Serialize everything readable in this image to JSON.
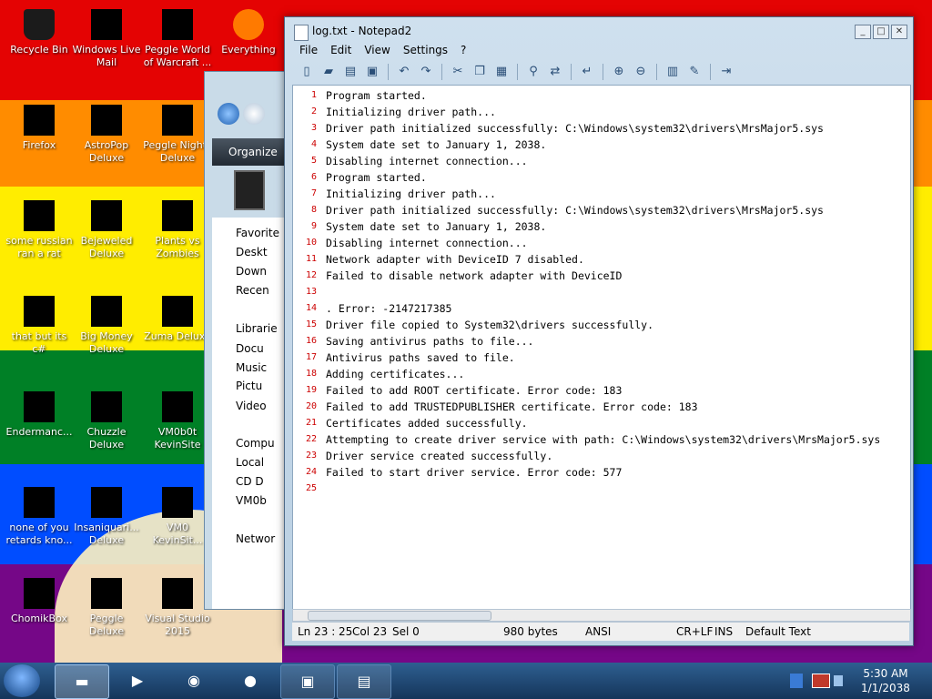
{
  "desktop": {
    "icons": [
      {
        "label": "Recycle Bin"
      },
      {
        "label": "Windows Live Mail"
      },
      {
        "label": "Peggle World of Warcraft ..."
      },
      {
        "label": "Everything"
      },
      {
        "label": "Firefox"
      },
      {
        "label": "AstroPop Deluxe"
      },
      {
        "label": "Peggle Nights Deluxe"
      },
      {
        "label": "some russian ran a rat"
      },
      {
        "label": "Bejeweled Deluxe"
      },
      {
        "label": "Plants vs Zombies"
      },
      {
        "label": "that but its c#"
      },
      {
        "label": "Big Money Deluxe"
      },
      {
        "label": "Zuma Deluxe"
      },
      {
        "label": "Endermanc..."
      },
      {
        "label": "Chuzzle Deluxe"
      },
      {
        "label": "VM0b0t KevinSite"
      },
      {
        "label": "none of you retards kno..."
      },
      {
        "label": "Insaniquari... Deluxe"
      },
      {
        "label": "VM0 KevinSit..."
      },
      {
        "label": "ChomikBox"
      },
      {
        "label": "Peggle Deluxe"
      },
      {
        "label": "Visual Studio 2015"
      }
    ],
    "stripe_colors": [
      "#e40303",
      "#ff8c00",
      "#ffed00",
      "#008026",
      "#004dff",
      "#750787"
    ]
  },
  "explorer": {
    "organize_label": "Organize",
    "sidebar": [
      "Favorite",
      "Deskt",
      "Down",
      "Recen",
      "Librarie",
      "Docu",
      "Music",
      "Pictu",
      "Video",
      "Compu",
      "Local",
      "CD D",
      "VM0b",
      "Networ"
    ]
  },
  "notepad": {
    "title": "log.txt - Notepad2",
    "menu": [
      "File",
      "Edit",
      "View",
      "Settings",
      "?"
    ],
    "lines": [
      {
        "n": "1",
        "text": "Program started."
      },
      {
        "n": "2",
        "text": "Initializing driver path..."
      },
      {
        "n": "3",
        "text": "Driver path initialized successfully: C:\\Windows\\system32\\drivers\\MrsMajor5.sys"
      },
      {
        "n": "4",
        "text": "System date set to January 1, 2038."
      },
      {
        "n": "5",
        "text": "Disabling internet connection..."
      },
      {
        "n": "6",
        "text": "Program started."
      },
      {
        "n": "7",
        "text": "Initializing driver path..."
      },
      {
        "n": "8",
        "text": "Driver path initialized successfully: C:\\Windows\\system32\\drivers\\MrsMajor5.sys"
      },
      {
        "n": "9",
        "text": "System date set to January 1, 2038."
      },
      {
        "n": "10",
        "text": "Disabling internet connection..."
      },
      {
        "n": "11",
        "text": "Network adapter with DeviceID 7 disabled."
      },
      {
        "n": "12",
        "text": "Failed to disable network adapter with DeviceID"
      },
      {
        "n": "13",
        "text": ""
      },
      {
        "n": "14",
        "text": ". Error: -2147217385"
      },
      {
        "n": "15",
        "text": "Driver file copied to System32\\drivers successfully."
      },
      {
        "n": "16",
        "text": "Saving antivirus paths to file..."
      },
      {
        "n": "17",
        "text": "Antivirus paths saved to file."
      },
      {
        "n": "18",
        "text": "Adding certificates..."
      },
      {
        "n": "19",
        "text": "Failed to add ROOT certificate. Error code: 183"
      },
      {
        "n": "20",
        "text": "Failed to add TRUSTEDPUBLISHER certificate. Error code: 183"
      },
      {
        "n": "21",
        "text": "Certificates added successfully."
      },
      {
        "n": "22",
        "text": "Attempting to create driver service with path: C:\\Windows\\system32\\drivers\\MrsMajor5.sys"
      },
      {
        "n": "23",
        "text": "Driver service created successfully."
      },
      {
        "n": "24",
        "text": "Failed to start driver service. Error code: 577"
      },
      {
        "n": "25",
        "text": ""
      }
    ],
    "status": {
      "position": "Ln 23 : 25",
      "col": "Col 23",
      "sel": "Sel 0",
      "size": "980 bytes",
      "encoding": "ANSI",
      "eol": "CR+LF",
      "mode": "INS",
      "scheme": "Default Text"
    }
  },
  "taskbar": {
    "time": "5:30 AM",
    "date": "1/1/2038"
  }
}
